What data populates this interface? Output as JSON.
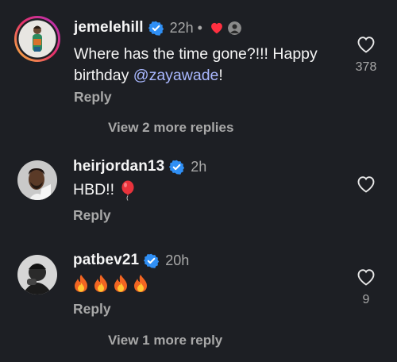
{
  "comments": [
    {
      "username": "jemelehill",
      "time": "22h",
      "dot": "•",
      "text_prefix": "Where has the time gone?!!! Happy birthday ",
      "mention": "@zayawade",
      "text_suffix": "!",
      "reply_label": "Reply",
      "like_count": "378",
      "view_more": "View 2 more replies"
    },
    {
      "username": "heirjordan13",
      "time": "2h",
      "text": "HBD!!",
      "reply_label": "Reply"
    },
    {
      "username": "patbev21",
      "time": "20h",
      "reply_label": "Reply",
      "like_count": "9",
      "view_more": "View 1 more reply"
    }
  ],
  "icons": {
    "verified": "verified-badge-icon",
    "heart": "heart-outline-icon",
    "liked_by_creator": "red-heart-icon",
    "balloon": "balloon-emoji",
    "fire": "fire-emoji"
  },
  "colors": {
    "background": "#1d1f24",
    "verified": "#2f8ff5",
    "mention": "#a9b8ff",
    "liked": "#ff3040"
  }
}
